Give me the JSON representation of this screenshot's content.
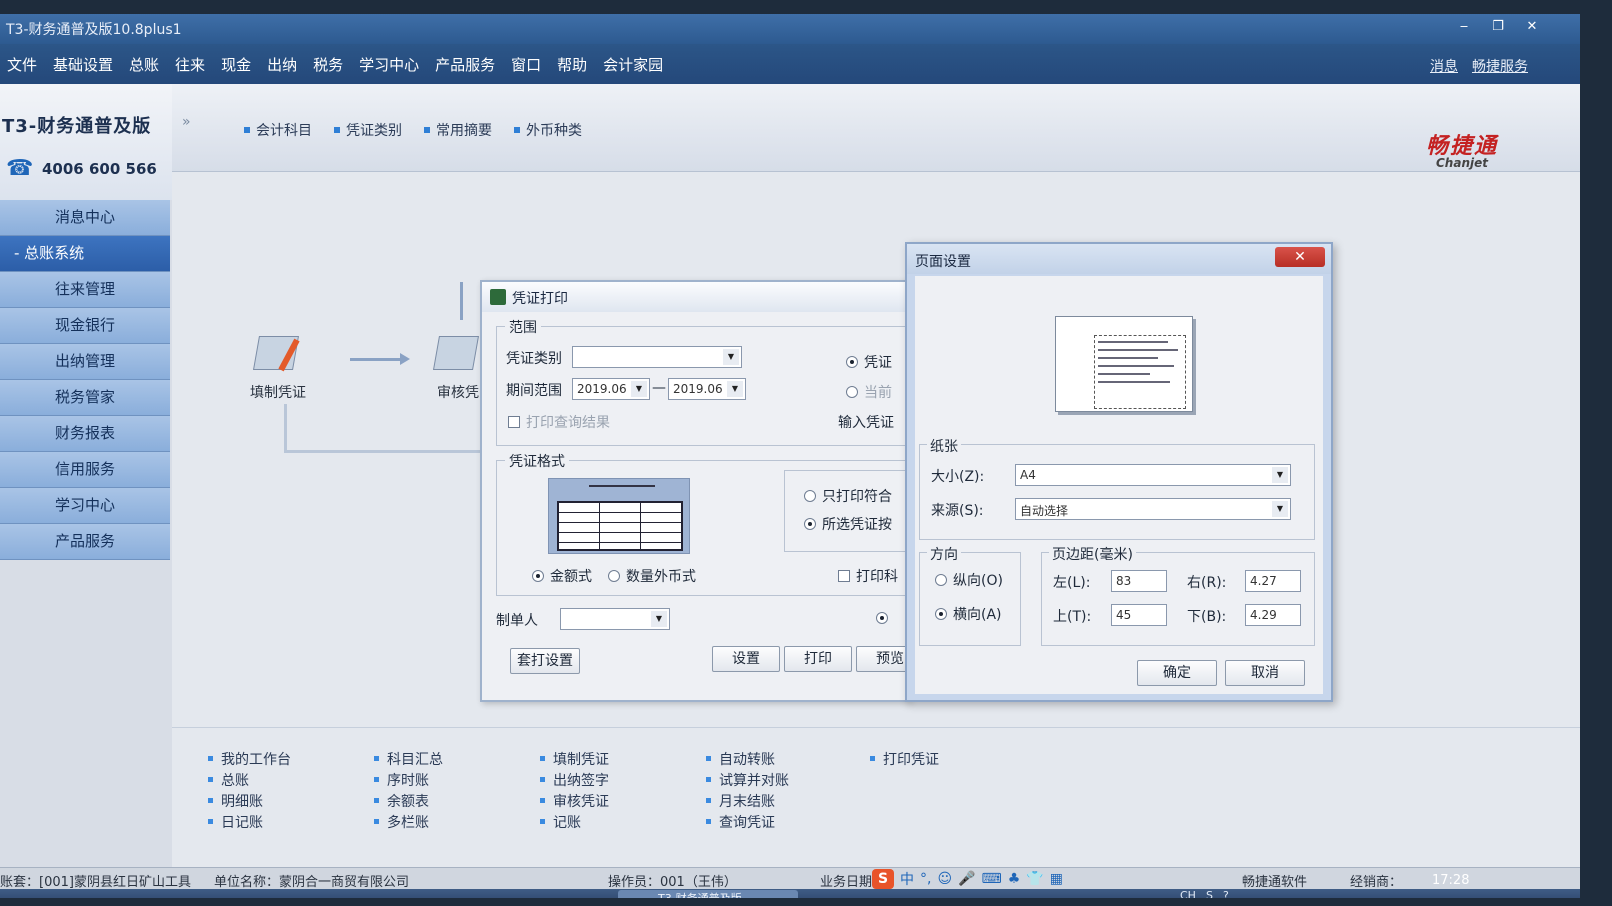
{
  "window": {
    "title": "T3-财务通普及版10.8plus1",
    "minimize": "‒",
    "restore": "❐",
    "close": "✕"
  },
  "menubar": {
    "items": [
      "文件",
      "基础设置",
      "总账",
      "往来",
      "现金",
      "出纳",
      "税务",
      "学习中心",
      "产品服务",
      "窗口",
      "帮助",
      "会计家园"
    ],
    "right": [
      "消息",
      "畅捷服务"
    ]
  },
  "brand": {
    "name": "T3-财务通普及版",
    "phone": "4006 600 566",
    "logo_cn": "畅捷通",
    "logo_en": "Chanjet"
  },
  "sidebar": {
    "items": [
      {
        "label": "消息中心",
        "active": false
      },
      {
        "label": "- 总账系统",
        "active": true
      },
      {
        "label": "往来管理",
        "active": false
      },
      {
        "label": "现金银行",
        "active": false
      },
      {
        "label": "出纳管理",
        "active": false
      },
      {
        "label": "税务管家",
        "active": false
      },
      {
        "label": "财务报表",
        "active": false
      },
      {
        "label": "信用服务",
        "active": false
      },
      {
        "label": "学习中心",
        "active": false
      },
      {
        "label": "产品服务",
        "active": false
      }
    ]
  },
  "quick_tabs": [
    "会计科目",
    "凭证类别",
    "常用摘要",
    "外币种类"
  ],
  "workflow": {
    "chevron": "»",
    "nodes": [
      "填制凭证",
      "审核凭"
    ]
  },
  "links": {
    "col1": [
      "我的工作台",
      "总账",
      "明细账",
      "日记账"
    ],
    "col2": [
      "科目汇总",
      "序时账",
      "余额表",
      "多栏账"
    ],
    "col3": [
      "填制凭证",
      "出纳签字",
      "审核凭证",
      "记账"
    ],
    "col4": [
      "自动转账",
      "试算并对账",
      "月末结账",
      "查询凭证"
    ],
    "col5": [
      "打印凭证"
    ]
  },
  "statusbar": {
    "account": "账套：[001]蒙阴县红日矿山工具",
    "company": "单位名称：蒙阴合一商贸有限公司",
    "operator": "操作员：001（王伟）",
    "business_date": "业务日期",
    "software": "畅捷通软件",
    "dealer": "经销商："
  },
  "ime": {
    "logo": "S",
    "icons": [
      "中",
      "°,",
      "☺",
      "🎤",
      "⌨",
      "♣",
      "👕",
      "▦"
    ]
  },
  "taskbar": {
    "active_app": "T3-财务通普及版",
    "clock": "17:28",
    "tray": [
      "CH",
      "S",
      "?"
    ],
    "badge": "5"
  },
  "print_dialog": {
    "title": "凭证打印",
    "range_group": "范围",
    "voucher_type_label": "凭证类别",
    "voucher_type_value": "",
    "period_label": "期间范围",
    "period_from": "2019.06",
    "period_to": "2019.06",
    "dash": "—",
    "print_query_result": "打印查询结果",
    "radio_voucher": "凭证",
    "radio_current": "当前",
    "input_voucher": "输入凭证",
    "format_group": "凭证格式",
    "format_amount": "金额式",
    "format_foreign": "数量外币式",
    "only_print": "只打印符合",
    "selected_print": "所选凭证按",
    "print_subject": "打印科",
    "maker_label": "制单人",
    "maker_value": "",
    "btn_template": "套打设置",
    "btn_settings": "设置",
    "btn_print": "打印",
    "btn_preview": "预览"
  },
  "page_setup": {
    "title": "页面设置",
    "close": "✕",
    "paper_group": "纸张",
    "size_label": "大小(Z):",
    "size_value": "A4",
    "source_label": "来源(S):",
    "source_value": "自动选择",
    "orientation_group": "方向",
    "portrait": "纵向(O)",
    "landscape": "横向(A)",
    "margins_group": "页边距(毫米)",
    "left_label": "左(L):",
    "left_value": "83",
    "right_label": "右(R):",
    "right_value": "4.27",
    "top_label": "上(T):",
    "top_value": "45",
    "bottom_label": "下(B):",
    "bottom_value": "4.29",
    "ok": "确定",
    "cancel": "取消"
  }
}
